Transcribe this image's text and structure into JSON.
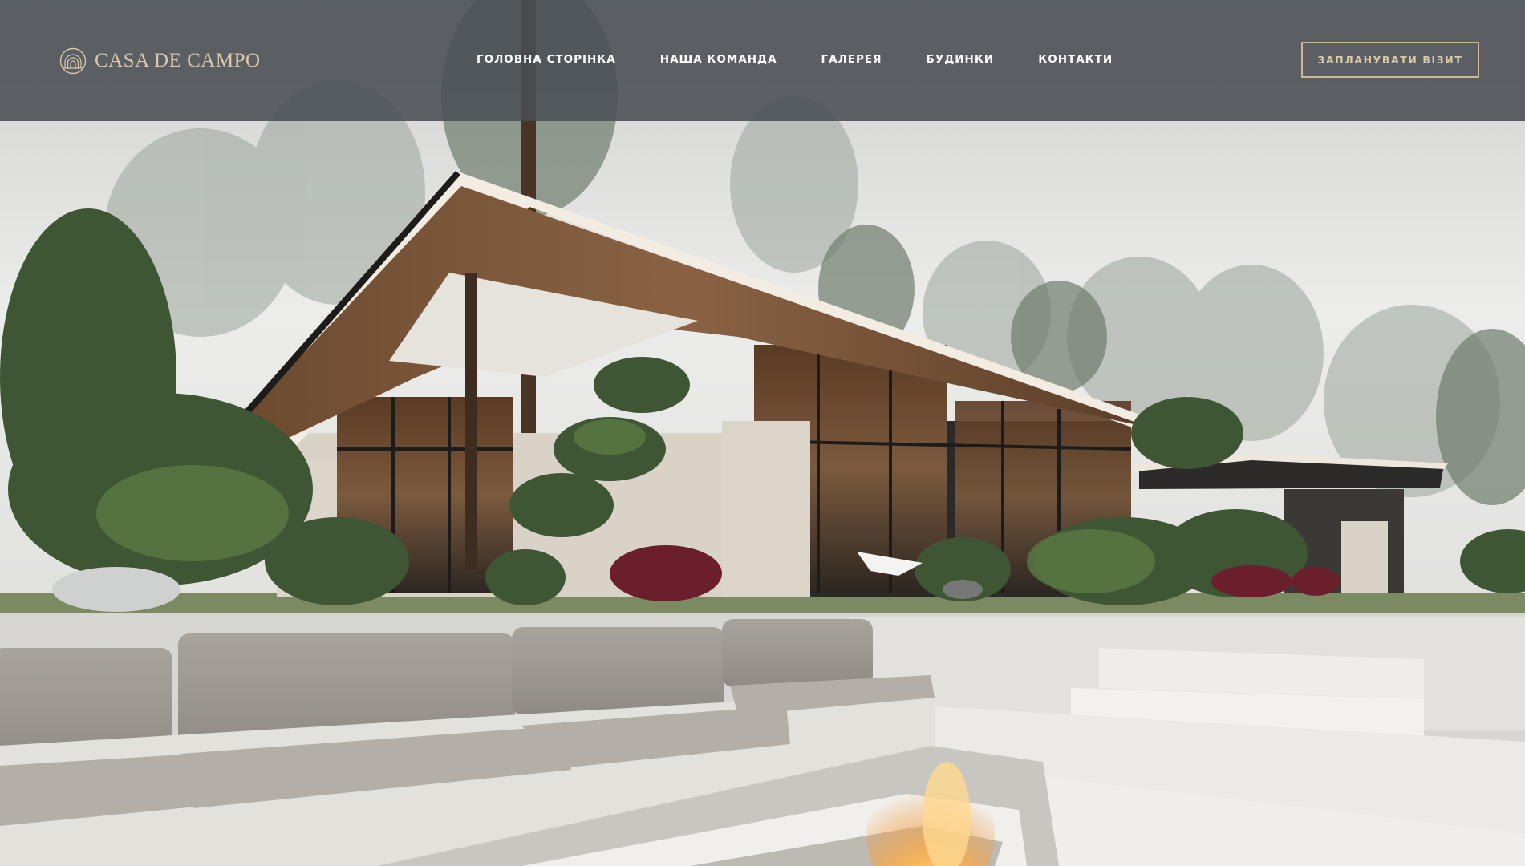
{
  "brand": {
    "name": "CASA DE CAMPO",
    "logo_icon": "arched-lines-logo-icon",
    "accent_color": "#d9c9a9"
  },
  "nav": {
    "items": [
      {
        "label": "ГОЛОВНА СТОРІНКА"
      },
      {
        "label": "НАША КОМАНДА"
      },
      {
        "label": "ГАЛЕРЕЯ"
      },
      {
        "label": "БУДИНКИ"
      },
      {
        "label": "КОНТАКТИ"
      }
    ]
  },
  "cta": {
    "label": "ЗАПЛАНУВАТИ ВІЗИТ"
  },
  "hero": {
    "image_subject": "modern-house-render",
    "header_overlay_color": "#4a4e54"
  }
}
